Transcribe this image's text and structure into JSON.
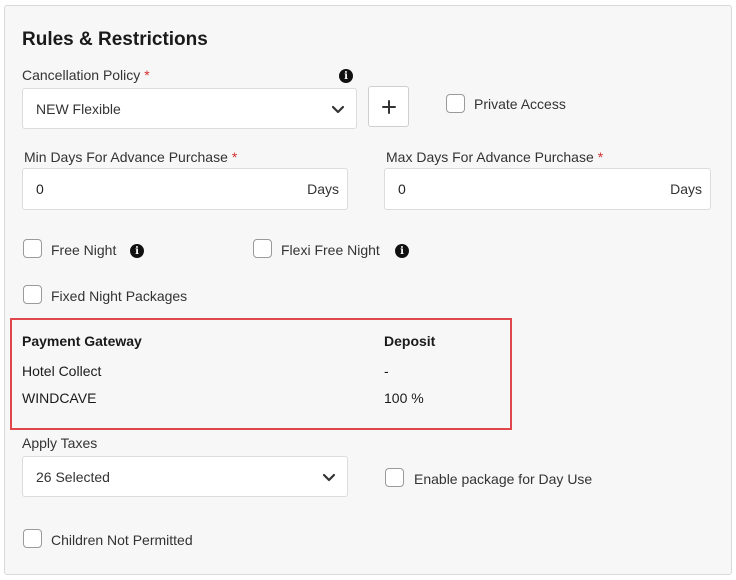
{
  "section": {
    "title": "Rules & Restrictions"
  },
  "cancellation_policy": {
    "label": "Cancellation Policy",
    "required_mark": "*",
    "selected": "NEW Flexible",
    "add_button": "+"
  },
  "private_access": {
    "label": "Private Access",
    "checked": false
  },
  "min_days": {
    "label": "Min Days For Advance Purchase",
    "required_mark": "*",
    "value": "0",
    "suffix": "Days"
  },
  "max_days": {
    "label": "Max Days For Advance Purchase",
    "required_mark": "*",
    "value": "0",
    "suffix": "Days"
  },
  "free_night": {
    "label": "Free Night",
    "checked": false
  },
  "flexi_free_night": {
    "label": "Flexi Free Night",
    "checked": false
  },
  "fixed_night_packages": {
    "label": "Fixed Night Packages",
    "checked": false
  },
  "payment_table": {
    "headers": {
      "gateway": "Payment Gateway",
      "deposit": "Deposit"
    },
    "rows": [
      {
        "gateway": "Hotel Collect",
        "deposit": "-"
      },
      {
        "gateway": "WINDCAVE",
        "deposit": "100 %"
      }
    ]
  },
  "apply_taxes": {
    "label": "Apply Taxes",
    "selected": "26 Selected"
  },
  "day_use": {
    "label": "Enable package for Day Use",
    "checked": false
  },
  "children_not_permitted": {
    "label": "Children Not Permitted",
    "checked": false
  },
  "icons": {
    "info": "i"
  },
  "colors": {
    "required": "#d32f2f",
    "highlight_border": "#e0474c"
  }
}
